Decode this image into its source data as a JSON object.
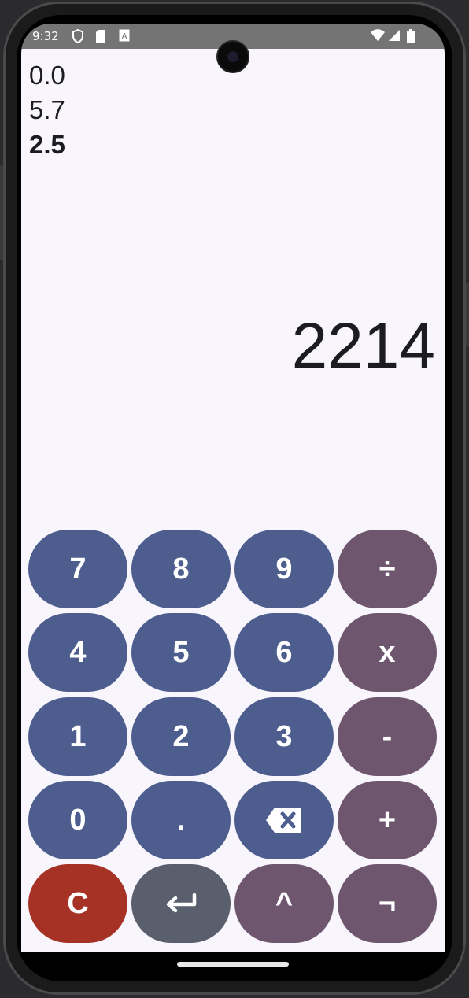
{
  "status_bar": {
    "time": "9:32",
    "left_icons": [
      "shield-icon",
      "sd-card-icon",
      "keyboard-a-icon"
    ],
    "right_icons": [
      "wifi-icon",
      "signal-icon",
      "battery-icon"
    ]
  },
  "history": {
    "lines": [
      "0.0",
      "5.7",
      "2.5"
    ]
  },
  "result": "2214",
  "keypad": {
    "rows": [
      [
        "7",
        "8",
        "9",
        "÷"
      ],
      [
        "4",
        "5",
        "6",
        "x"
      ],
      [
        "1",
        "2",
        "3",
        "-"
      ],
      [
        "0",
        ".",
        "backspace-icon",
        "+"
      ],
      [
        "C",
        "enter-icon",
        "^",
        "¬"
      ]
    ]
  },
  "colors": {
    "digit_key": "#4c5d8e",
    "operator_key": "#6e566e",
    "clear_key": "#a63225",
    "enter_key": "#5a5f6e",
    "background": "#f8f5fd"
  }
}
